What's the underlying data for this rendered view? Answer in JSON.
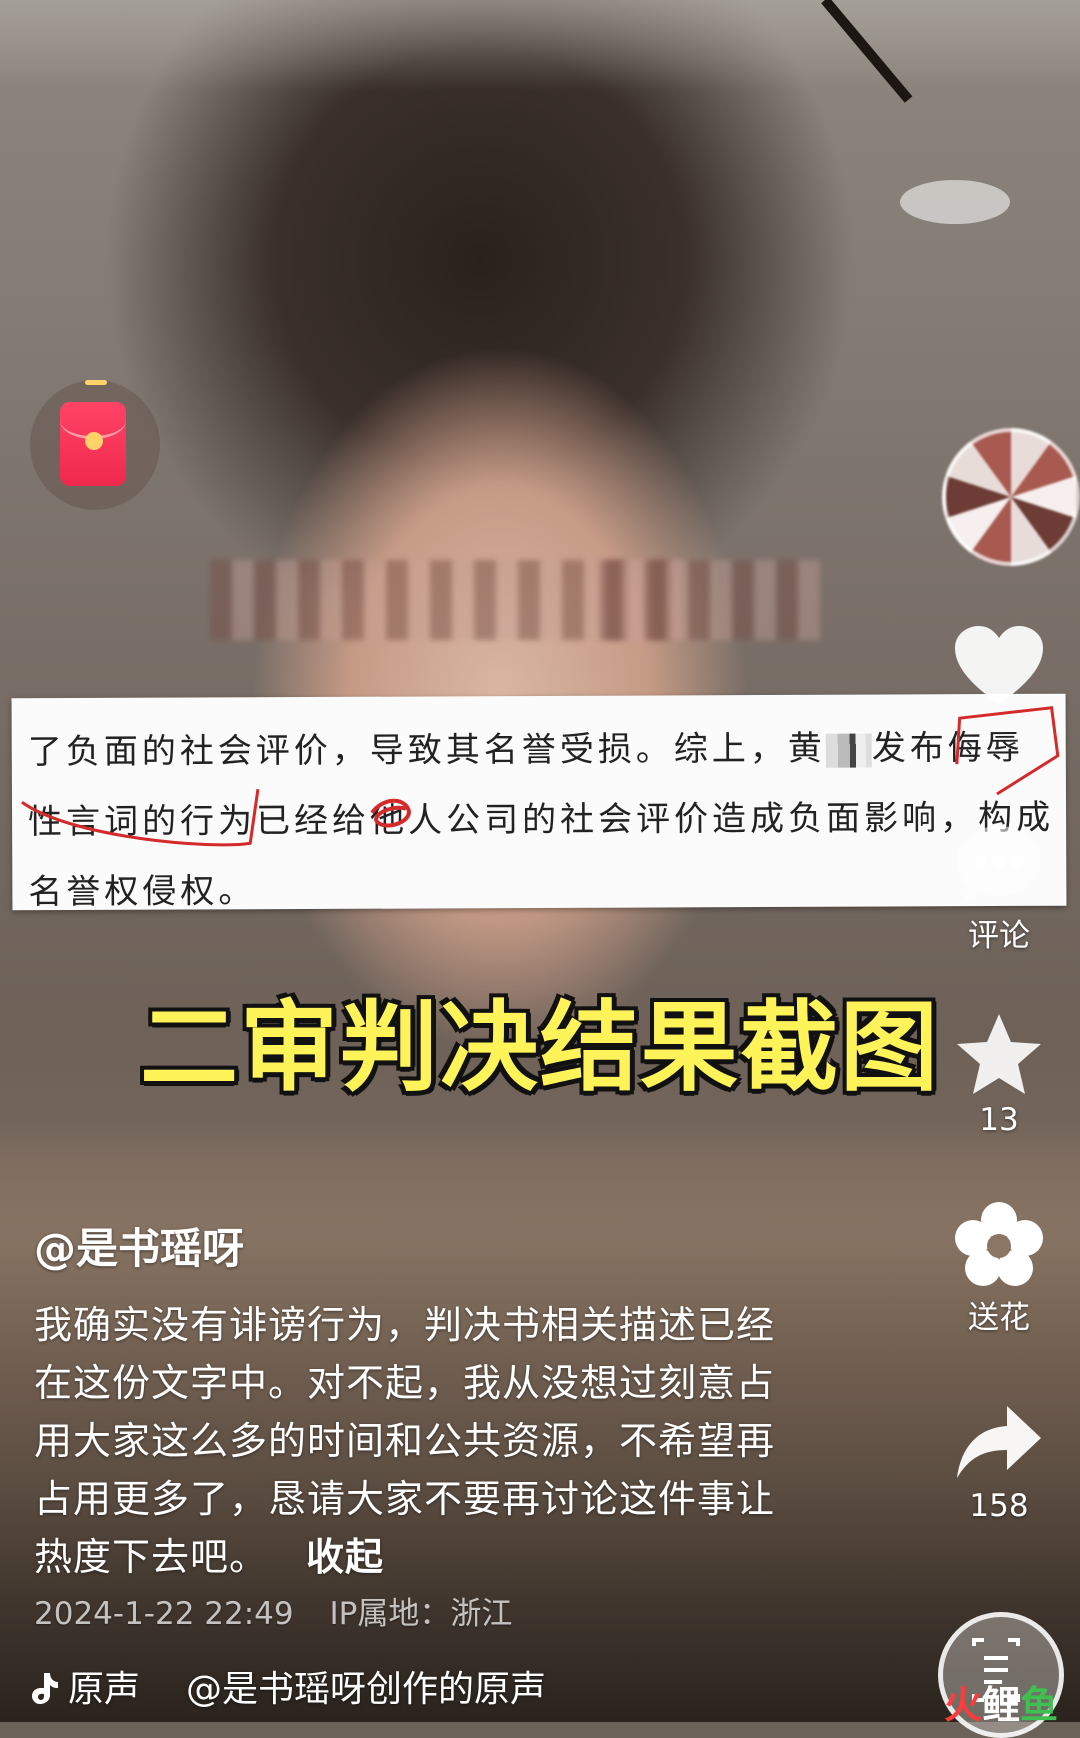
{
  "document_excerpt": {
    "line1_a": "了负面的社会评价，导致其名誉受损。综上，黄",
    "line1_b": "发布侮辱",
    "line2": "性言词的行为已经给他人公司的社会评价造成负面影响，构成",
    "line3": "名誉权侵权。"
  },
  "caption": "二审判决结果截图",
  "actions": {
    "comment_label": "评论",
    "favorite_count": "13",
    "gift_label": "送花",
    "share_count": "158"
  },
  "post": {
    "author": "@是书瑶呀",
    "description_lines": [
      "我确实没有诽谤行为，判决书相关描述已经",
      "在这份文字中。对不起，我从没想过刻意占",
      "用大家这么多的时间和公共资源，不希望再",
      "占用更多了，恳请大家不要再讨论这件事让",
      "热度下去吧。"
    ],
    "collapse_label": "收起",
    "date": "2024-1-22 22:49",
    "ip_location": "IP属地：浙江",
    "music_prefix": "原声",
    "music_text": "@是书瑶呀创作的原声"
  },
  "icons": {
    "red_envelope": "red-envelope-icon",
    "like": "heart-icon",
    "comment": "comment-bubble-icon",
    "favorite": "star-icon",
    "gift": "flower-icon",
    "share": "share-arrow-icon",
    "recognize": "scan-text-icon",
    "music": "tiktok-note-icon"
  },
  "watermark": {
    "part1": "火",
    "part2": "鲤",
    "part3": "鱼"
  },
  "colors": {
    "caption_yellow": "#fff35a",
    "red_envelope": "#f0284e",
    "annotation_red": "#d42a2a"
  }
}
